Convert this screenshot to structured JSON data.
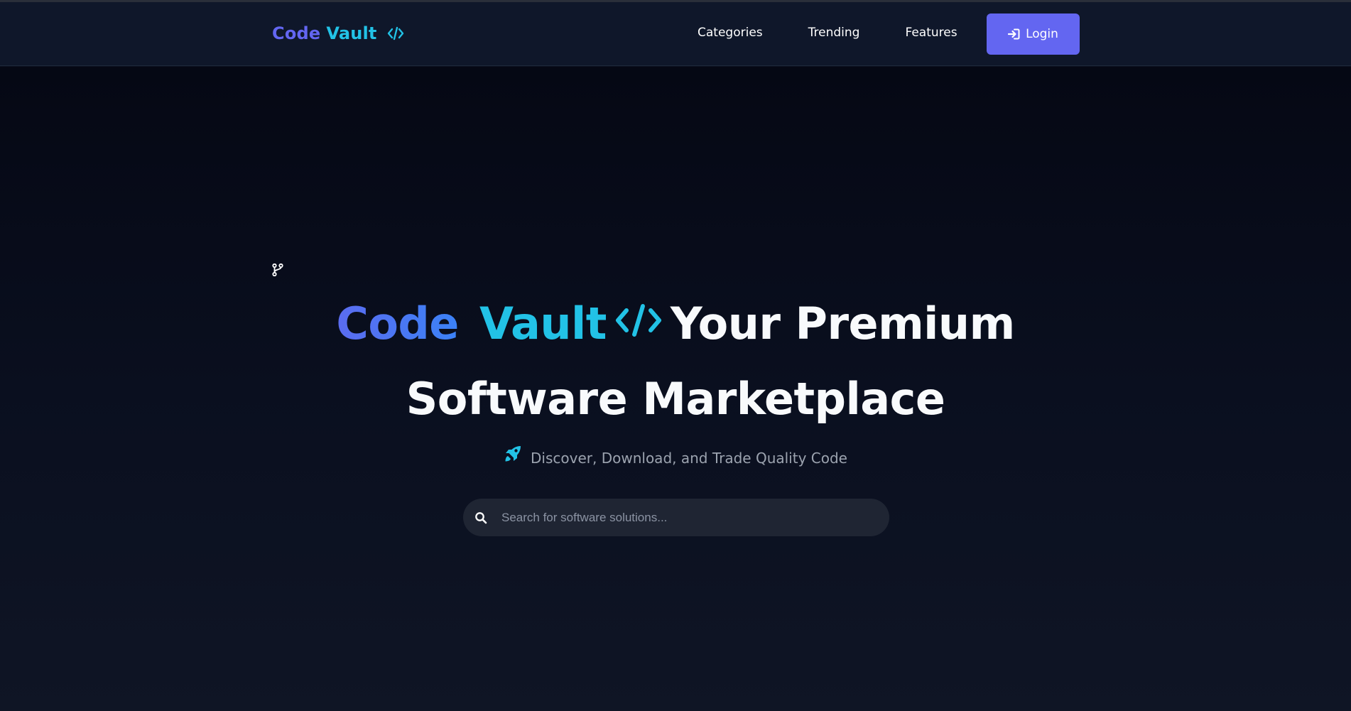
{
  "brand": {
    "word1": "Code",
    "word2": "Vault",
    "icon": "code-icon"
  },
  "nav": {
    "links": [
      {
        "label": "Categories"
      },
      {
        "label": "Trending"
      },
      {
        "label": "Features"
      }
    ],
    "login": {
      "label": "Login",
      "icon": "sign-in-icon"
    }
  },
  "hero": {
    "title_word1": "Code",
    "title_word2": "Vault",
    "title_rest_line1": "Your Premium",
    "title_line2": "Software Marketplace",
    "subtitle": "Discover, Download, and Trade Quality Code",
    "subtitle_icon": "rocket-icon",
    "branch_icon": "code-branch-icon"
  },
  "search": {
    "placeholder": "Search for software solutions...",
    "value": "",
    "icon": "search-icon"
  },
  "colors": {
    "accent": "#6366f1",
    "cyan": "#22c2e6",
    "nav_bg": "#0f172a",
    "hero_bg": "#050814",
    "search_bg": "#1f2533"
  }
}
